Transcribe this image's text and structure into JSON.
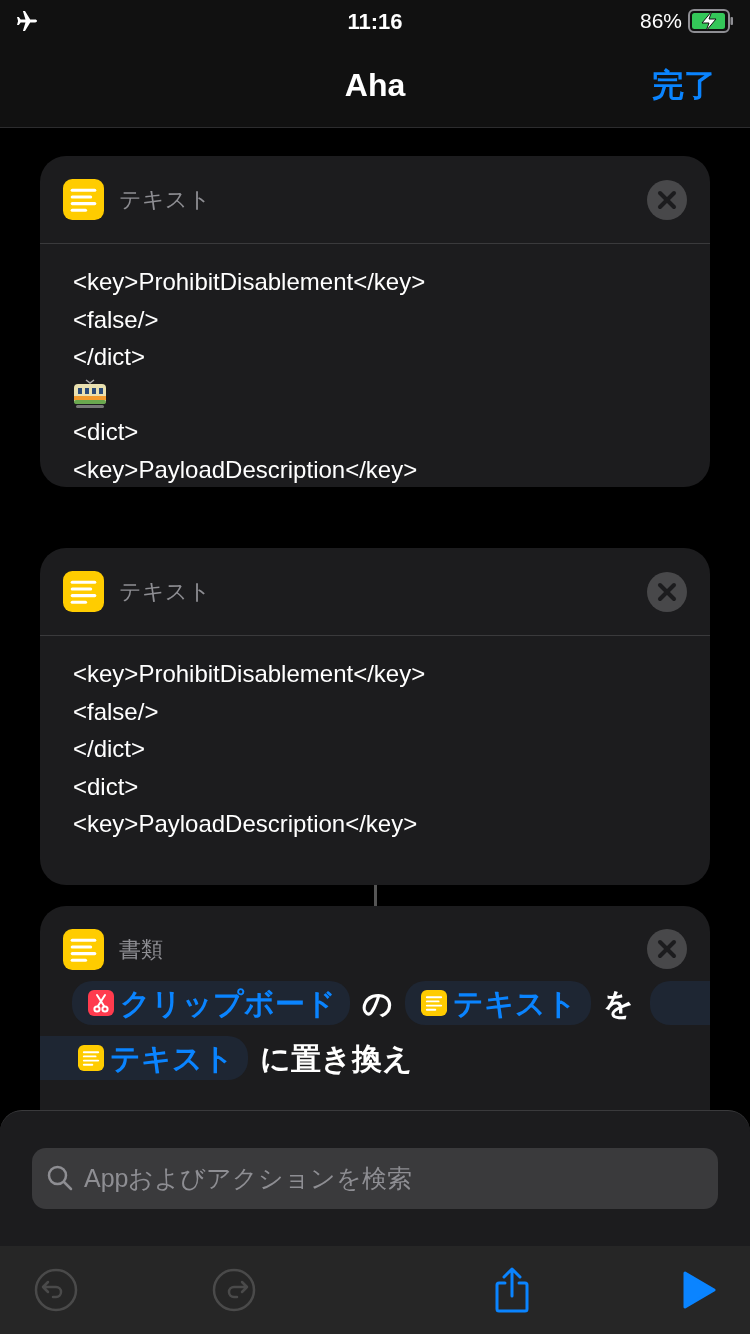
{
  "status_bar": {
    "time": "11:16",
    "battery": "86%",
    "airplane_mode": true,
    "charging": true
  },
  "nav": {
    "title": "Aha",
    "done": "完了"
  },
  "actions": [
    {
      "kind": "text",
      "title": "テキスト",
      "lines": [
        {
          "kind": "text",
          "text": "<key>ProhibitDisablement</key>"
        },
        {
          "kind": "text",
          "text": "<false/>"
        },
        {
          "kind": "text",
          "text": "</dict>"
        },
        {
          "kind": "tram"
        },
        {
          "kind": "text",
          "text": "<dict>"
        },
        {
          "kind": "text",
          "text": "<key>PayloadDescription</key>"
        }
      ]
    },
    {
      "kind": "text",
      "title": "テキスト",
      "lines": [
        {
          "kind": "text",
          "text": "<key>ProhibitDisablement</key>"
        },
        {
          "kind": "text",
          "text": "<false/>"
        },
        {
          "kind": "text",
          "text": "</dict>"
        },
        {
          "kind": "text",
          "text": "<dict>"
        },
        {
          "kind": "text",
          "text": "<key>PayloadDescription</key>"
        }
      ]
    },
    {
      "kind": "replace",
      "title": "書類",
      "rows": [
        [
          {
            "kind": "clipboard",
            "label": "クリップボード"
          },
          {
            "kind": "word",
            "label": "の"
          },
          {
            "kind": "variable",
            "label": "テキスト"
          },
          {
            "kind": "word",
            "label": "を"
          },
          {
            "kind": "blank"
          }
        ],
        [
          {
            "kind": "variable",
            "label": "テキスト",
            "continued": true
          },
          {
            "kind": "word",
            "label": "に置き換え"
          }
        ]
      ]
    }
  ],
  "search": {
    "placeholder": "Appおよびアクションを検索"
  },
  "toolbar": {
    "undo_disabled": true,
    "redo_disabled": true
  }
}
